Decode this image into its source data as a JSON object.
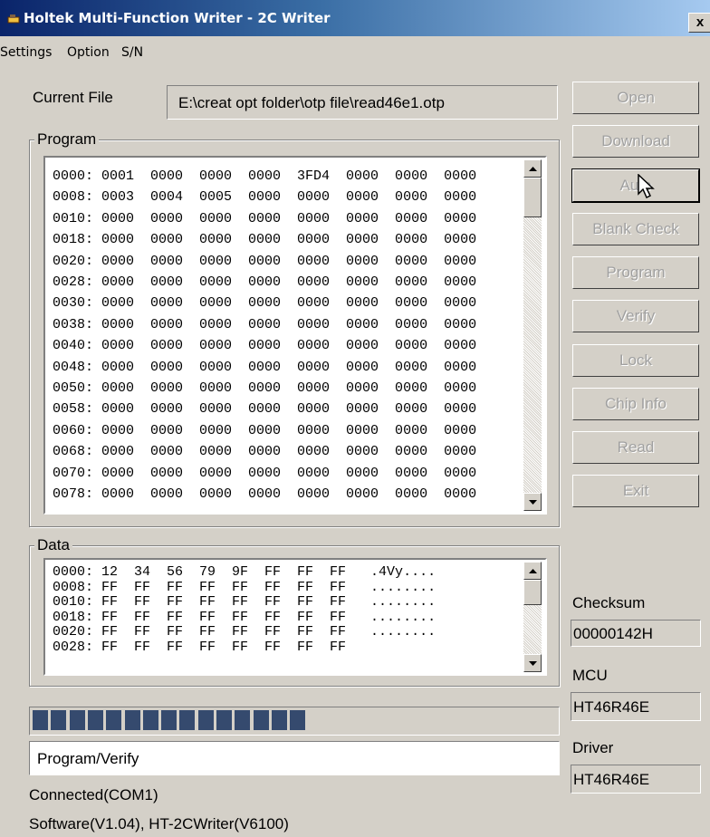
{
  "window": {
    "title": "Holtek Multi-Function Writer - 2C Writer",
    "close": "x"
  },
  "menu": [
    "Settings",
    "Option",
    "S/N"
  ],
  "current_file": {
    "label": "Current File",
    "value": "E:\\creat opt folder\\otp file\\read46e1.otp"
  },
  "program": {
    "legend": "Program",
    "rows": [
      "0000: 0001  0000  0000  0000  3FD4  0000  0000  0000",
      "0008: 0003  0004  0005  0000  0000  0000  0000  0000",
      "0010: 0000  0000  0000  0000  0000  0000  0000  0000",
      "0018: 0000  0000  0000  0000  0000  0000  0000  0000",
      "0020: 0000  0000  0000  0000  0000  0000  0000  0000",
      "0028: 0000  0000  0000  0000  0000  0000  0000  0000",
      "0030: 0000  0000  0000  0000  0000  0000  0000  0000",
      "0038: 0000  0000  0000  0000  0000  0000  0000  0000",
      "0040: 0000  0000  0000  0000  0000  0000  0000  0000",
      "0048: 0000  0000  0000  0000  0000  0000  0000  0000",
      "0050: 0000  0000  0000  0000  0000  0000  0000  0000",
      "0058: 0000  0000  0000  0000  0000  0000  0000  0000",
      "0060: 0000  0000  0000  0000  0000  0000  0000  0000",
      "0068: 0000  0000  0000  0000  0000  0000  0000  0000",
      "0070: 0000  0000  0000  0000  0000  0000  0000  0000",
      "0078: 0000  0000  0000  0000  0000  0000  0000  0000"
    ]
  },
  "data": {
    "legend": "Data",
    "rows": [
      "0000: 12  34  56  79  9F  FF  FF  FF   .4Vy....",
      "0008: FF  FF  FF  FF  FF  FF  FF  FF   ........",
      "0010: FF  FF  FF  FF  FF  FF  FF  FF   ........",
      "0018: FF  FF  FF  FF  FF  FF  FF  FF   ........",
      "0020: FF  FF  FF  FF  FF  FF  FF  FF   ........",
      "0028: FF  FF  FF  FF  FF  FF  FF  FF"
    ]
  },
  "buttons": [
    "Open",
    "Download",
    "Auto",
    "Blank Check",
    "Program",
    "Verify",
    "Lock",
    "Chip Info",
    "Read",
    "Exit"
  ],
  "checksum": {
    "label": "Checksum",
    "value": "00000142H"
  },
  "mcu": {
    "label": "MCU",
    "value": "HT46R46E"
  },
  "driver": {
    "label": "Driver",
    "value": "HT46R46E"
  },
  "progress": {
    "filled_segments": 15,
    "fraction": 0.52
  },
  "status": {
    "message": "Program/Verify",
    "connection": "Connected(COM1)",
    "software": "Software(V1.04),  HT-2CWriter(V6100)"
  }
}
